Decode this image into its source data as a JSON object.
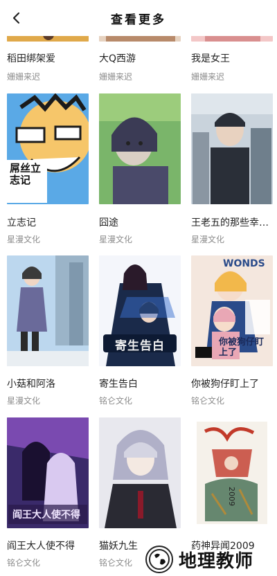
{
  "header": {
    "title": "查看更多",
    "back_icon": "chevron-left-icon"
  },
  "rows": [
    [
      {
        "title": "稻田绑架爱",
        "author": "姗姗来迟",
        "palette": [
          "#f2c94c",
          "#e0a94a",
          "#5b3b2a"
        ]
      },
      {
        "title": "大Q西游",
        "author": "姗姗来迟",
        "palette": [
          "#e6d2c0",
          "#b88a6a",
          "#7a4a3a"
        ]
      },
      {
        "title": "我是女王",
        "author": "姗姗来迟",
        "palette": [
          "#f3c7c7",
          "#d98f8f",
          "#6a3a3a"
        ]
      }
    ],
    [
      {
        "title": "立志记",
        "author": "星漫文化",
        "palette": [
          "#f6c66a",
          "#5aa9e6",
          "#1b1b1b"
        ]
      },
      {
        "title": "囧途",
        "author": "星漫文化",
        "palette": [
          "#7ab56a",
          "#d9cfc4",
          "#3b3b55"
        ]
      },
      {
        "title": "王老五的那些幸…",
        "author": "星漫文化",
        "palette": [
          "#c9d3dc",
          "#6f7f8c",
          "#2a2f38"
        ]
      }
    ],
    [
      {
        "title": "小菇和阿洛",
        "author": "星漫文化",
        "palette": [
          "#bcd7ee",
          "#6a6a9a",
          "#3a3a3a"
        ]
      },
      {
        "title": "寄生告白",
        "author": "铭仑文化",
        "palette": [
          "#1a2a4a",
          "#3a6fd0",
          "#f0f0f0"
        ]
      },
      {
        "title": "你被狗仔盯上了",
        "author": "铭仑文化",
        "palette": [
          "#f4e7de",
          "#e9a7b5",
          "#2a4b8a"
        ]
      }
    ],
    [
      {
        "title": "阎王大人使不得",
        "author": "铭仑文化",
        "palette": [
          "#3a2a6a",
          "#d9c9f0",
          "#7a4ab0"
        ]
      },
      {
        "title": "猫妖九生",
        "author": "铭仑文化",
        "palette": [
          "#e8e8ee",
          "#2a2a33",
          "#b0b0c8"
        ]
      },
      {
        "title": "药神异闻2009",
        "author": "",
        "palette": [
          "#f5f1ea",
          "#c23a2a",
          "#2a5a3a"
        ]
      }
    ]
  ],
  "cover_text": {
    "row1_col0": "屌丝立志记",
    "row2_col1": "寄生告白",
    "row2_col2_top": "WONDS",
    "row2_col2_bottom": "你被狗仔盯上了",
    "row3_col0": "阎王大人使不得",
    "row3_col2": "2009"
  },
  "watermark": {
    "text": "地理教师",
    "icon": "globe-icon"
  }
}
